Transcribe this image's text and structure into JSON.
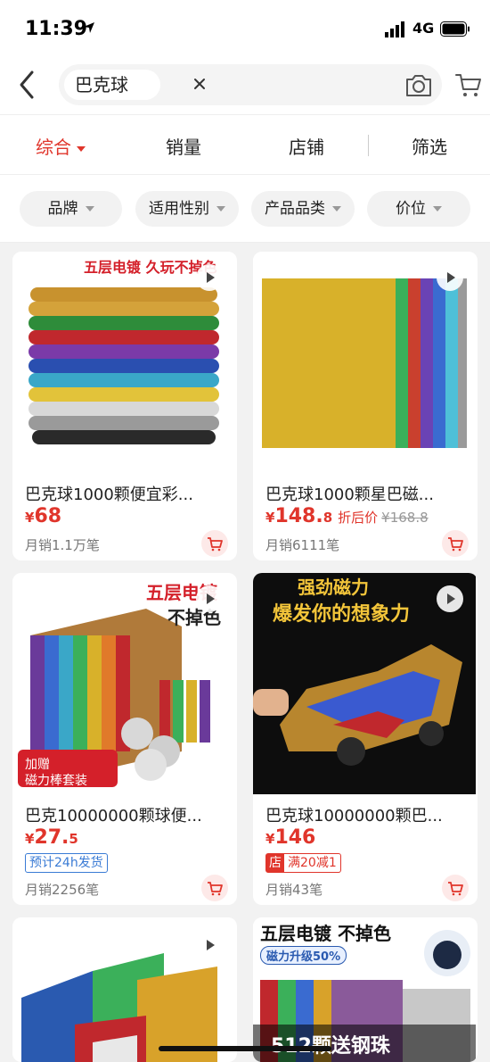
{
  "status_bar": {
    "time": "11:39",
    "network": "4G"
  },
  "search": {
    "query": "巴克球"
  },
  "sort_tabs": [
    {
      "label": "综合",
      "active": true
    },
    {
      "label": "销量",
      "active": false
    },
    {
      "label": "店铺",
      "active": false
    },
    {
      "label": "筛选",
      "active": false
    }
  ],
  "filters": [
    {
      "label": "品牌"
    },
    {
      "label": "适用性别"
    },
    {
      "label": "产品品类"
    },
    {
      "label": "价位"
    }
  ],
  "products": [
    {
      "image_banner": "五层电镀 久玩不掉色",
      "title": "巴克球1000颗便宜彩...",
      "price_symbol": "¥",
      "price_main": "68",
      "price_decimal": "",
      "sales": "月销1.1万笔"
    },
    {
      "title": "巴克球1000颗星巴磁...",
      "price_symbol": "¥",
      "price_main": "148.",
      "price_decimal": "8",
      "discount_label": "折后价",
      "original_price": "¥168.8",
      "sales": "月销6111笔"
    },
    {
      "image_heading_1": "五层电镀",
      "image_heading_2": "不掉色",
      "image_badge_1": "加赠",
      "image_badge_2": "磁力棒套装",
      "title": "巴克10000000颗球便...",
      "price_symbol": "¥",
      "price_main": "27.",
      "price_decimal": "5",
      "tag": "预计24h发货",
      "sales": "月销2256笔"
    },
    {
      "image_heading_1": "强劲磁力",
      "image_heading_2": "爆发你的想象力",
      "title": "巴克球10000000颗巴...",
      "price_symbol": "¥",
      "price_main": "146",
      "price_decimal": "",
      "tag_shop": "店",
      "tag": "满20减1",
      "sales": "月销43笔"
    },
    {},
    {
      "image_heading_1": "五层电镀 不掉色",
      "image_tag": "磁力升级50%",
      "image_footer": "512颗送钢珠"
    }
  ],
  "colors": {
    "accent": "#e0352b",
    "blue": "#3a7bd5"
  }
}
